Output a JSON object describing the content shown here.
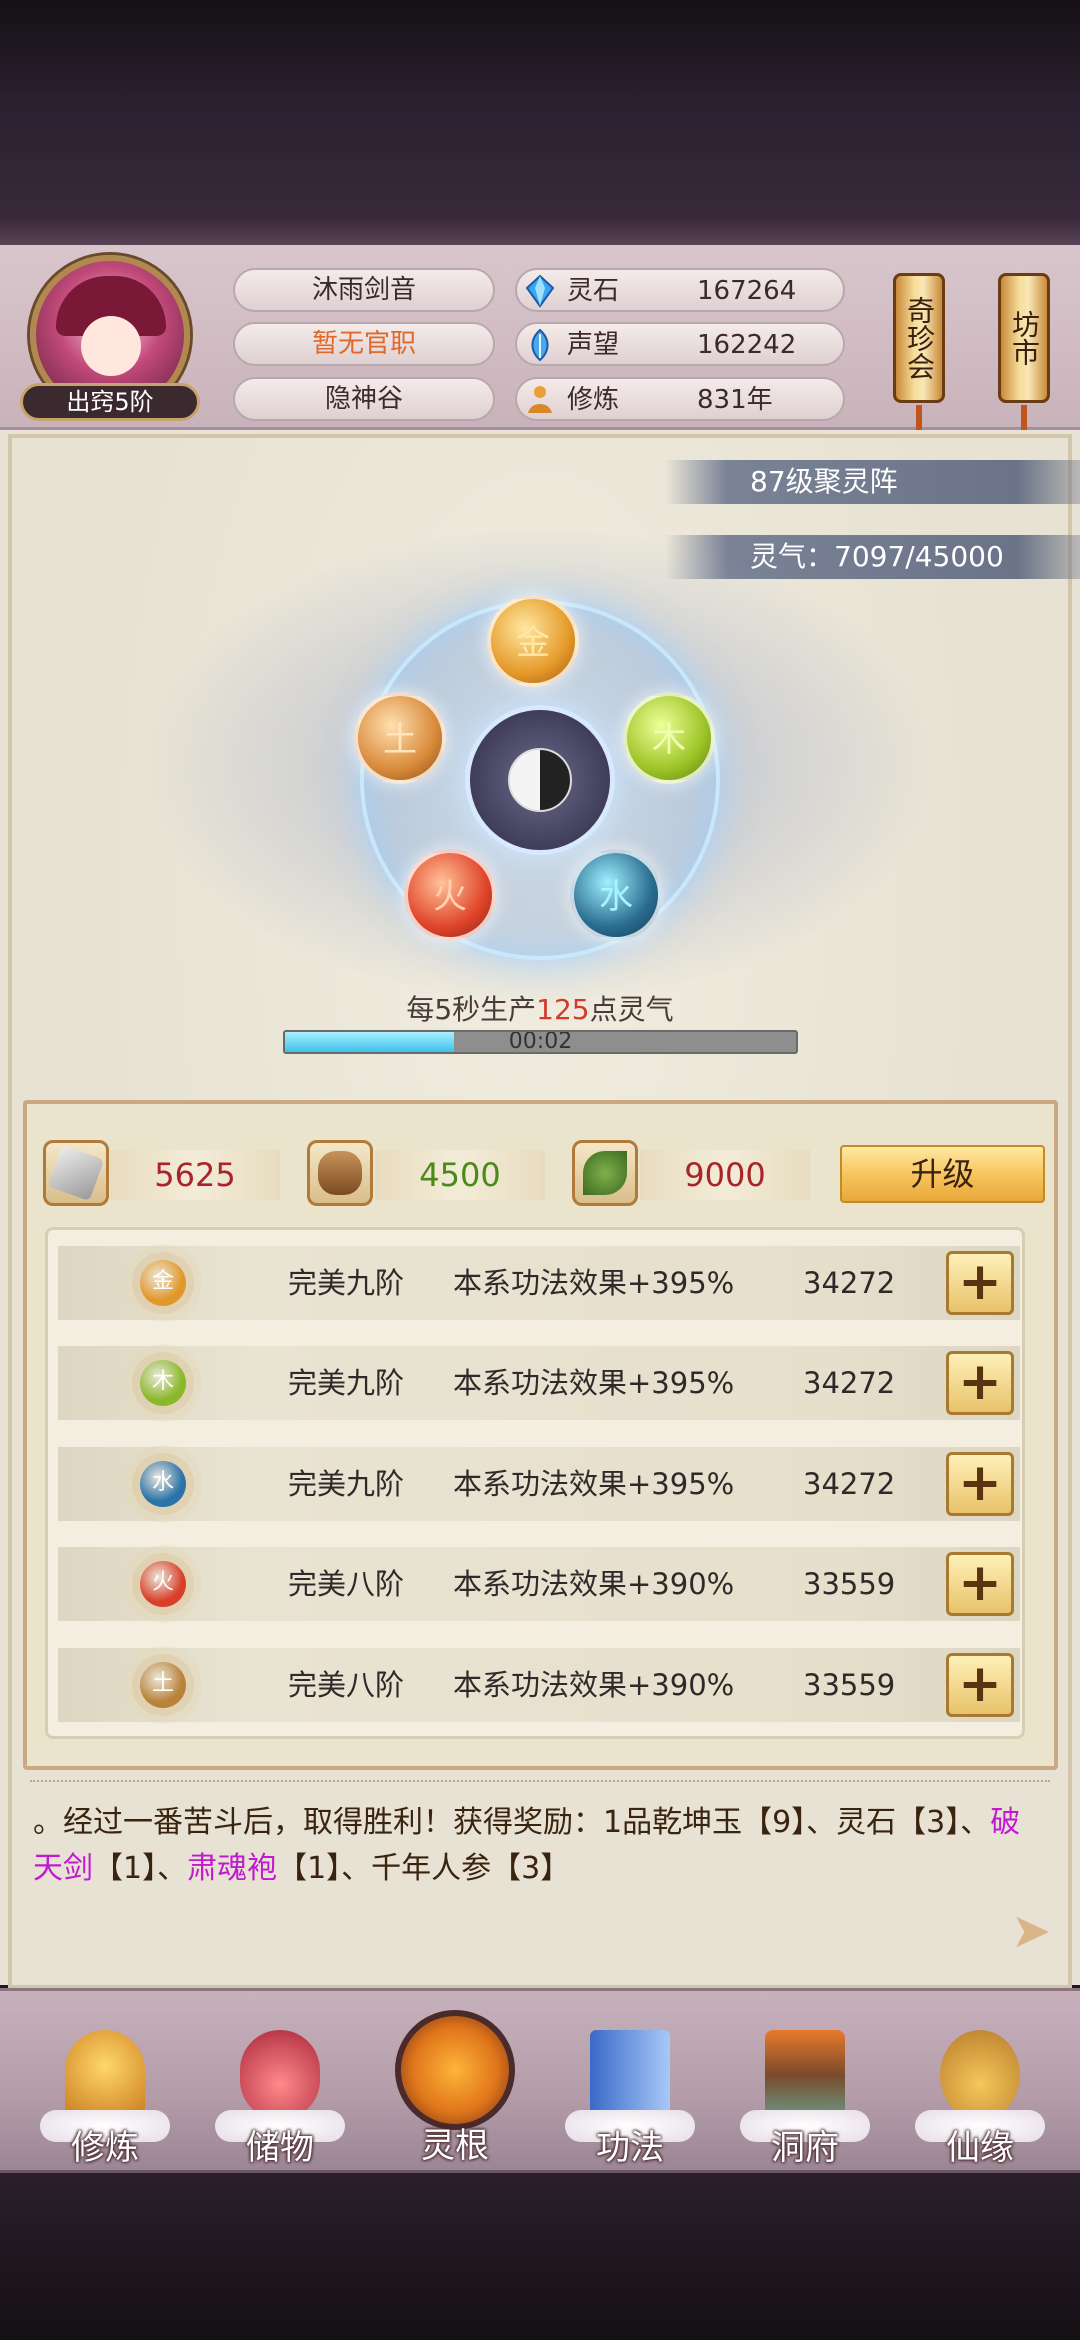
{
  "player": {
    "rank": "出窍5阶",
    "name": "沐雨剑音",
    "official_title": "暂无官职",
    "sect": "隐神谷"
  },
  "resources": [
    {
      "icon": "blue-crystal-icon",
      "label": "灵石",
      "value": "167264"
    },
    {
      "icon": "blue-feather-icon",
      "label": "声望",
      "value": "162242"
    },
    {
      "icon": "meditation-icon",
      "label": "修炼",
      "value": "831年"
    }
  ],
  "shops": {
    "treasure": "奇珍会",
    "market": "坊市"
  },
  "array": {
    "level_label": "87级聚灵阵",
    "qi_label": "灵气：7097/45000",
    "elements": {
      "gold": "金",
      "wood": "木",
      "water": "水",
      "fire": "火",
      "earth": "土"
    },
    "production_prefix": "每5秒生产",
    "production_rate": "125",
    "production_suffix": "点灵气",
    "timer": "00:02",
    "progress": 0.33
  },
  "upgrade": {
    "costs": [
      {
        "icon": "ore-icon",
        "value": "5625",
        "color": "#a8242a"
      },
      {
        "icon": "wood-logs-icon",
        "value": "4500",
        "color": "#4a8a1a"
      },
      {
        "icon": "herb-icon",
        "value": "9000",
        "color": "#a8242a"
      }
    ],
    "button_label": "升级"
  },
  "roots": [
    {
      "element": "金",
      "grade": "完美九阶",
      "effect": "本系功法效果+395%",
      "value": "34272",
      "color": "#e0982a"
    },
    {
      "element": "木",
      "grade": "完美九阶",
      "effect": "本系功法效果+395%",
      "value": "34272",
      "color": "#8ab82a"
    },
    {
      "element": "水",
      "grade": "完美九阶",
      "effect": "本系功法效果+395%",
      "value": "34272",
      "color": "#2a72a8"
    },
    {
      "element": "火",
      "grade": "完美八阶",
      "effect": "本系功法效果+390%",
      "value": "33559",
      "color": "#d8402a"
    },
    {
      "element": "土",
      "grade": "完美八阶",
      "effect": "本系功法效果+390%",
      "value": "33559",
      "color": "#b8823a"
    }
  ],
  "plus_label": "+",
  "log": {
    "part1": "。经过一番苦斗后，取得胜利！获得奖励：1品乾坤玉【9】、灵石【3】、",
    "item1": "破天剑",
    "part2": "【1】、",
    "item2": "肃魂袍",
    "part3": "【1】、千年人参【3】",
    "highlight_color": "#c21ad0"
  },
  "nav": [
    {
      "label": "修炼",
      "icon": "cultivate-icon"
    },
    {
      "label": "储物",
      "icon": "storage-bag-icon"
    },
    {
      "label": "灵根",
      "icon": "spirit-root-icon"
    },
    {
      "label": "功法",
      "icon": "technique-book-icon"
    },
    {
      "label": "洞府",
      "icon": "cave-house-icon"
    },
    {
      "label": "仙缘",
      "icon": "immortal-gourd-icon"
    }
  ]
}
